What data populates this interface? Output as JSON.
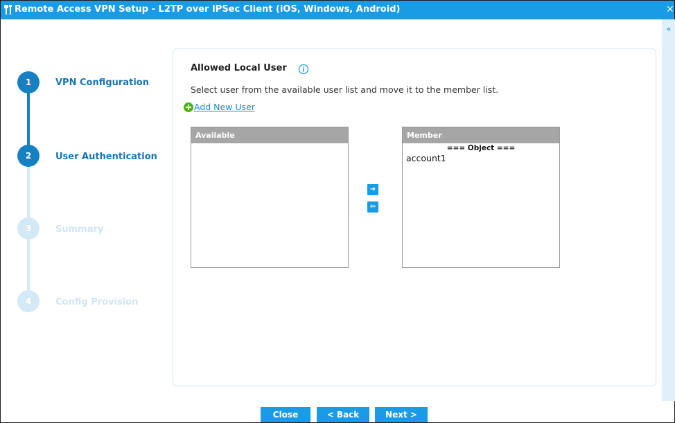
{
  "window": {
    "title": "Remote Access VPN Setup - L2TP over IPSec Client (iOS, Windows, Android)",
    "close_icon": "close-x-icon",
    "collapse_label": "«"
  },
  "colors": {
    "titlebar": "#1a9be6",
    "step_active": "#1580c2",
    "step_inactive": "#d4e9f6",
    "step_label_active": "#1874b3",
    "link": "#1a8ad8",
    "list_header": "#a6a6a6"
  },
  "steps": [
    {
      "number": "1",
      "label": "VPN Configuration",
      "state": "done"
    },
    {
      "number": "2",
      "label": "User Authentication",
      "state": "current"
    },
    {
      "number": "3",
      "label": "Summary",
      "state": "pending"
    },
    {
      "number": "4",
      "label": "Config Provision",
      "state": "pending"
    }
  ],
  "section": {
    "title": "Allowed Local User",
    "info_icon": "info-icon",
    "description": "Select user from the available user list and move it to the member list.",
    "add_link": "Add New User",
    "add_icon": "plus-circle-icon"
  },
  "available": {
    "header": "Available",
    "items": []
  },
  "member": {
    "header": "Member",
    "group_heading": "=== Object ===",
    "items": [
      "account1"
    ]
  },
  "move_buttons": {
    "add_icon": "arrow-right-icon",
    "add_glyph": "➜",
    "remove_icon": "arrow-left-icon",
    "remove_glyph": "⇦"
  },
  "footer": {
    "close": "Close",
    "back": "< Back",
    "next": "Next >"
  }
}
